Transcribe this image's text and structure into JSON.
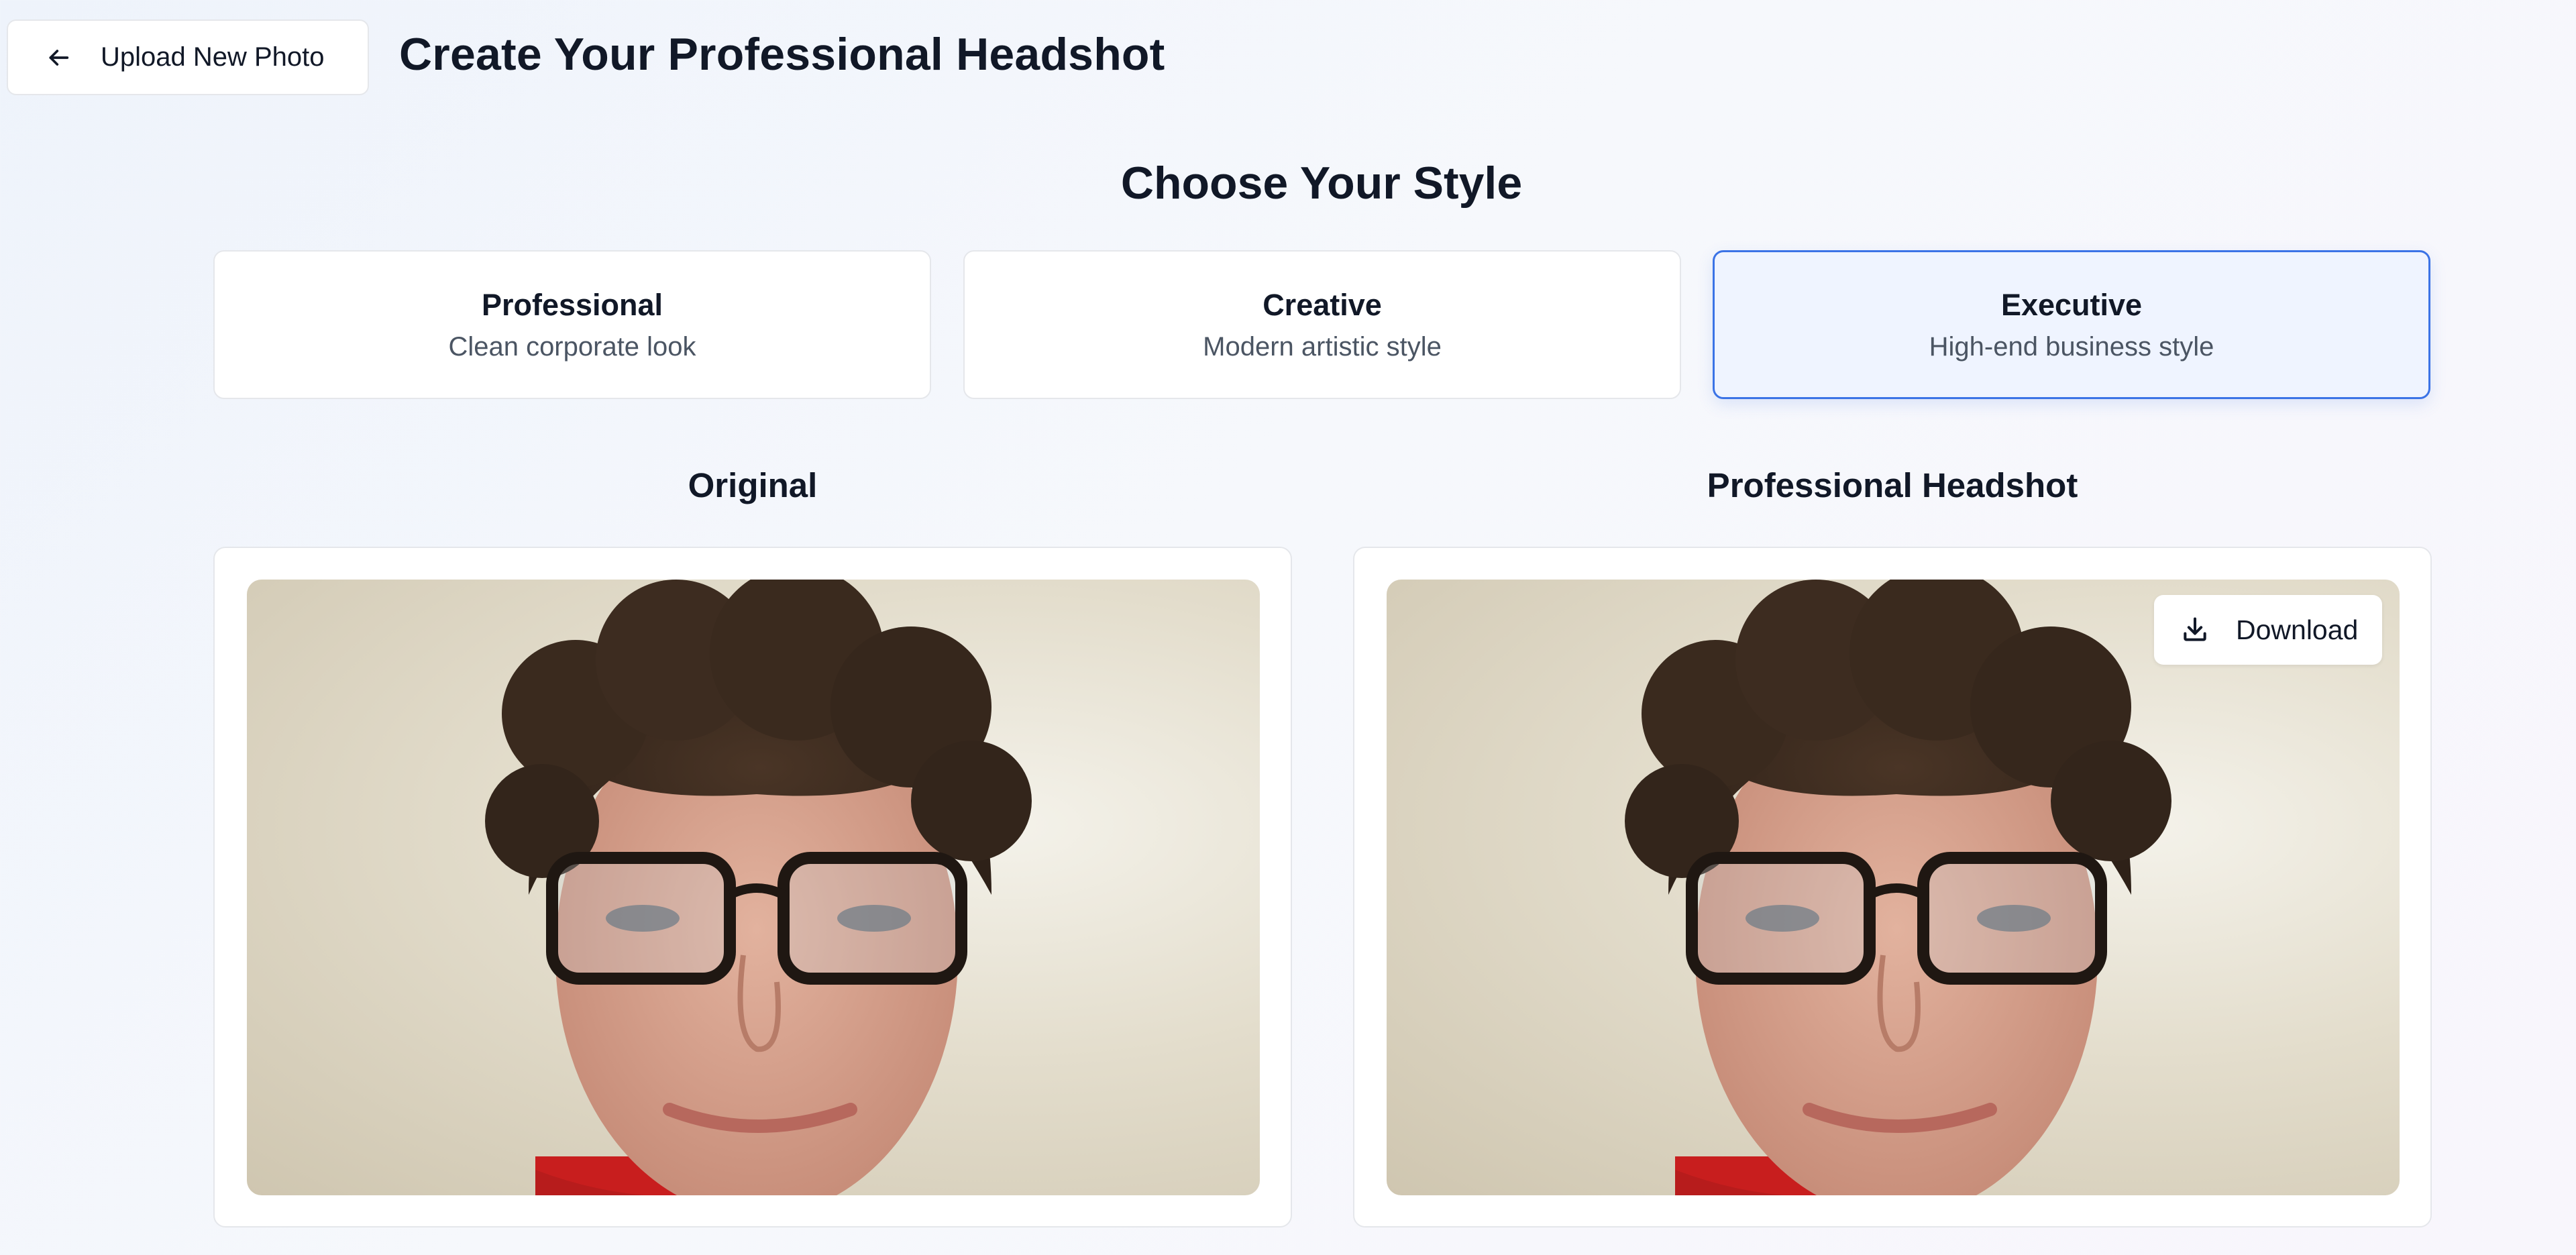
{
  "header": {
    "back_label": "Upload New Photo",
    "title": "Create Your Professional Headshot"
  },
  "style_section": {
    "title": "Choose Your Style",
    "options": [
      {
        "name": "Professional",
        "description": "Clean corporate look"
      },
      {
        "name": "Creative",
        "description": "Modern artistic style"
      },
      {
        "name": "Executive",
        "description": "High-end business style"
      }
    ],
    "selected": "Executive"
  },
  "comparison": {
    "original_title": "Original",
    "result_title": "Professional Headshot",
    "download_label": "Download"
  },
  "icons": {
    "back": "arrow-left-icon",
    "download": "download-icon"
  },
  "colors": {
    "accent": "#3b73e6",
    "selected_bg": "#eff4ff"
  }
}
